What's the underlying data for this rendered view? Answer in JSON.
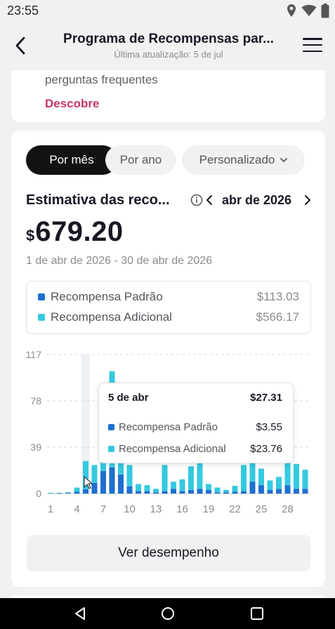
{
  "status_bar": {
    "time": "23:55",
    "icons": [
      "location-icon",
      "wifi-icon",
      "battery-icon"
    ]
  },
  "header": {
    "title": "Programa de Recompensas par...",
    "subtitle": "Última atualização: 5 de jul"
  },
  "top_card": {
    "text": "perguntas frequentes",
    "link": "Descobre"
  },
  "filters": {
    "monthly": "Por mês",
    "yearly": "Por ano",
    "custom": "Personalizado",
    "selected": "Por mês"
  },
  "estimate": {
    "title": "Estimativa das reco...",
    "month": "abr de 2026",
    "currency": "$",
    "amount": "679.20",
    "date_range": "1 de abr de 2026 - 30 de abr de 2026"
  },
  "legend": [
    {
      "label": "Recompensa Padrão",
      "value": "$113.03",
      "color": "#1e6fd0"
    },
    {
      "label": "Recompensa Adicional",
      "value": "$566.17",
      "color": "#35c9e0"
    }
  ],
  "tooltip": {
    "date": "5 de abr",
    "total": "$27.31",
    "rows": [
      {
        "label": "Recompensa Padrão",
        "value": "$3.55"
      },
      {
        "label": "Recompensa Adicional",
        "value": "$23.76"
      }
    ]
  },
  "chart_data": {
    "type": "bar",
    "stacked": true,
    "x": [
      1,
      2,
      3,
      4,
      5,
      6,
      7,
      8,
      9,
      10,
      11,
      12,
      13,
      14,
      15,
      16,
      17,
      18,
      19,
      20,
      21,
      22,
      23,
      24,
      25,
      26,
      27,
      28,
      29,
      30
    ],
    "x_tick_labels": [
      "1",
      "4",
      "7",
      "10",
      "13",
      "16",
      "19",
      "22",
      "25",
      "28"
    ],
    "y_tick_labels": [
      "0",
      "39",
      "78",
      "117"
    ],
    "ylim": [
      0,
      117
    ],
    "highlighted_day": 5,
    "grid": true,
    "series": [
      {
        "name": "Recompensa Padrão",
        "color": "#1e6fd0",
        "values": [
          0,
          0.3,
          0.5,
          1.5,
          3.55,
          9,
          19,
          22,
          16,
          6,
          2,
          2,
          1,
          2,
          4,
          2,
          3,
          4,
          3,
          1,
          1,
          1.5,
          2,
          10,
          7,
          3,
          4,
          7,
          4,
          4
        ]
      },
      {
        "name": "Recompensa Adicional",
        "color": "#35c9e0",
        "values": [
          0.6,
          0.3,
          0.5,
          3.5,
          23.76,
          15,
          68,
          81,
          25,
          18,
          6,
          5,
          3,
          22,
          6,
          10,
          20,
          22,
          5,
          4,
          2,
          5,
          22,
          16,
          14,
          8,
          10,
          20,
          21,
          16
        ]
      }
    ]
  },
  "cta_label": "Ver desempenho"
}
